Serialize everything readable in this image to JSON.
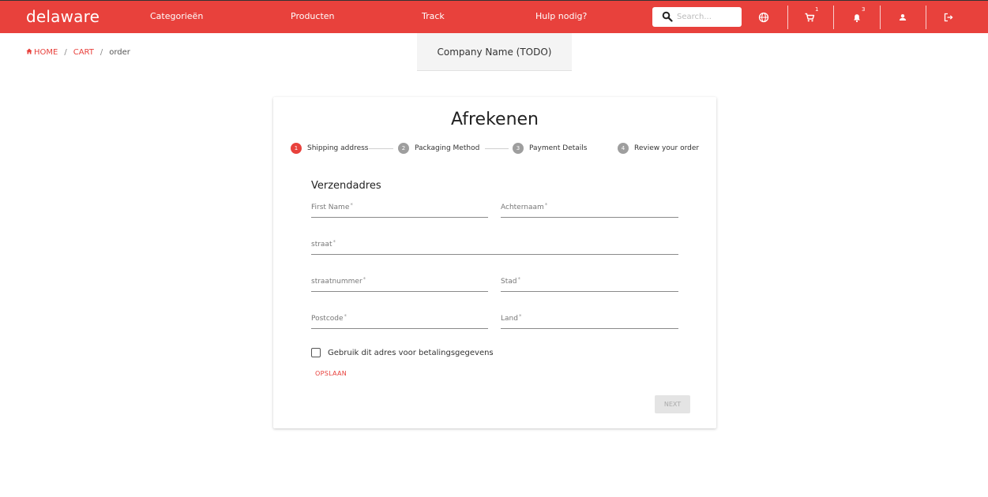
{
  "topbar": {
    "brand": "delaware",
    "nav": [
      "Categorieën",
      "Producten",
      "Track",
      "Hulp nodig?"
    ],
    "search_placeholder": "Search...",
    "cart_count": "1",
    "notification_count": "3"
  },
  "breadcrumb": {
    "home": "HOME",
    "cart": "CART",
    "current": "order"
  },
  "company_name": "Company Name (TODO)",
  "checkout": {
    "title": "Afrekenen",
    "steps": [
      {
        "number": "1",
        "label": "Shipping address",
        "active": true
      },
      {
        "number": "2",
        "label": "Packaging Method",
        "active": false
      },
      {
        "number": "3",
        "label": "Payment Details",
        "active": false
      },
      {
        "number": "4",
        "label": "Review your order",
        "active": false
      }
    ],
    "section_title": "Verzendadres",
    "fields": {
      "first_name": "First Name",
      "last_name": "Achternaam",
      "street": "straat",
      "street_number": "straatnummer",
      "city": "Stad",
      "postcode": "Postcode",
      "country": "Land",
      "required_mark": "*"
    },
    "checkbox_label": "Gebruik dit adres voor betalingsgegevens",
    "save_label": "OPSLAAN",
    "next_label": "NEXT"
  },
  "colors": {
    "accent": "#e8413c",
    "step_inactive": "#9e9e9e",
    "panel": "#f4f4f4"
  }
}
